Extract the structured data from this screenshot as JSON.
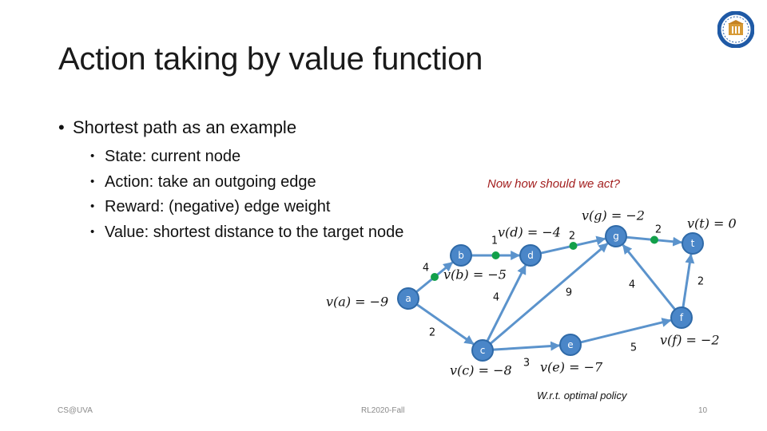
{
  "slide": {
    "title": "Action taking by value function",
    "bullet": "Shortest path as an example",
    "sub_bullets": [
      "State: current node",
      "Action: take an outgoing edge",
      "Reward: (negative) edge weight",
      "Value: shortest distance to the target node"
    ],
    "question": "Now how should we act?",
    "caption": "W.r.t. optimal policy",
    "bullet_glyph": "•",
    "logo_icon": "university-seal-icon"
  },
  "footer": {
    "left": "CS@UVA",
    "center": "RL2020-Fall",
    "page": "10"
  },
  "colors": {
    "node_fill": "#4a86c8",
    "edge": "#5b93cc",
    "policy_dot": "#12a04a",
    "question_text": "#a31f1f"
  },
  "graph": {
    "nodes": [
      {
        "id": "a",
        "label": "a",
        "value_label": "v(a) = −9",
        "value": -9
      },
      {
        "id": "b",
        "label": "b",
        "value_label": "v(b) = −5",
        "value": -5
      },
      {
        "id": "c",
        "label": "c",
        "value_label": "v(c) = −8",
        "value": -8
      },
      {
        "id": "d",
        "label": "d",
        "value_label": "v(d) = −4",
        "value": -4
      },
      {
        "id": "e",
        "label": "e",
        "value_label": "v(e) = −7",
        "value": -7
      },
      {
        "id": "f",
        "label": "f",
        "value_label": "v(f) = −2",
        "value": -2
      },
      {
        "id": "g",
        "label": "g",
        "value_label": "v(g) = −2",
        "value": -2
      },
      {
        "id": "t",
        "label": "t",
        "value_label": "v(t) = 0",
        "value": 0
      }
    ],
    "edges": [
      {
        "from": "a",
        "to": "b",
        "weight": "4",
        "optimal": true
      },
      {
        "from": "a",
        "to": "c",
        "weight": "2",
        "optimal": false
      },
      {
        "from": "b",
        "to": "d",
        "weight": "1",
        "optimal": true
      },
      {
        "from": "c",
        "to": "d",
        "weight": "4",
        "optimal": false
      },
      {
        "from": "c",
        "to": "g",
        "weight": "9",
        "optimal": false
      },
      {
        "from": "c",
        "to": "e",
        "weight": "3",
        "optimal": false
      },
      {
        "from": "d",
        "to": "g",
        "weight": "2",
        "optimal": true
      },
      {
        "from": "e",
        "to": "f",
        "weight": "5",
        "optimal": false
      },
      {
        "from": "f",
        "to": "g",
        "weight": "4",
        "optimal": false
      },
      {
        "from": "f",
        "to": "t",
        "weight": "2",
        "optimal": false
      },
      {
        "from": "g",
        "to": "t",
        "weight": "2",
        "optimal": true
      }
    ]
  }
}
